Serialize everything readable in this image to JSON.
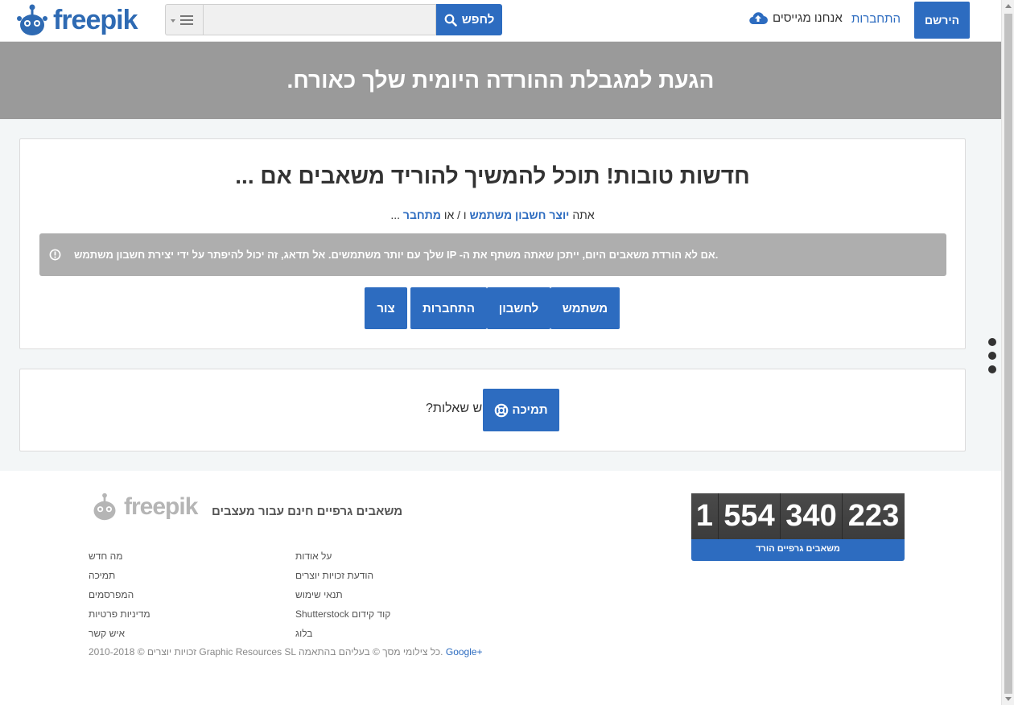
{
  "header": {
    "logo_text": "freepik",
    "search_button": "לחפש",
    "search_placeholder": "",
    "register_button": "הירשם",
    "login_link": "התחברות",
    "contributors_link": "אנחנו מגייסים"
  },
  "banner": {
    "title": "הגעת למגבלת ההורדה היומית שלך כאורח."
  },
  "card_main": {
    "headline": "... חדשות טובות! תוכל להמשיך להוריד משאבים אם",
    "sub_prefix": "אתה",
    "sub_link_create": "יוצר חשבון משתמש",
    "sub_middle": "ו / או",
    "sub_link_login": "מתחבר",
    "sub_suffix": "...",
    "alert_text": "שלך עם יותר משתמשים. אל תדאג, זה יכול להיפתר על ידי יצירת חשבון משתמש IP -אם לא הורדת משאבים היום, ייתכן שאתה משתף את ה.",
    "buttons": [
      "צור",
      "התחברות",
      "לחשבון",
      "משתמש"
    ]
  },
  "card_support": {
    "questions": "?יש שאלות",
    "support_button": "תמיכה"
  },
  "footer": {
    "logo_text": "freepik",
    "tagline": "משאבים גרפיים חינם עבור מעצבים",
    "col1": [
      "מה חדש",
      "תמיכה",
      "המפרסמים",
      "מדיניות פרטיות",
      "איש קשר"
    ],
    "col2": [
      "על אודות",
      "הודעת זכויות יוצרים",
      "תנאי שימוש",
      "Shutterstock קוד קידום",
      "בלוג"
    ],
    "copyright_main": "2010-2018 © זכויות יוצרים Graphic Resources SL כל צילומי מסך © בעליהם בהתאמה.",
    "copyright_gplus": "Google+",
    "counter_groups": [
      "1",
      "554",
      "340",
      "223"
    ],
    "counter_label": "משאבים גרפיים הורד"
  },
  "colors": {
    "brand_blue": "#2d6cc0",
    "banner_gray": "#9a9a9a",
    "alert_gray": "#aeaeae"
  }
}
